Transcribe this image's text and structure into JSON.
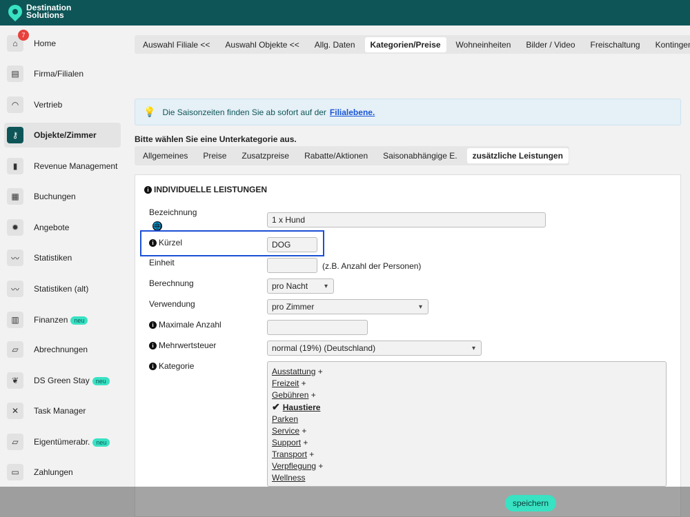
{
  "brand": {
    "line1": "Destination",
    "line2": "Solutions"
  },
  "nav": [
    {
      "label": "Home",
      "icon": "home-icon",
      "glyph": "⌂",
      "badge_count": "7",
      "neu": ""
    },
    {
      "label": "Firma/Filialen",
      "icon": "building-icon",
      "glyph": "▤",
      "neu": ""
    },
    {
      "label": "Vertrieb",
      "icon": "gauge-icon",
      "glyph": "◠",
      "neu": ""
    },
    {
      "label": "Objekte/Zimmer",
      "icon": "key-icon",
      "glyph": "⚷",
      "neu": ""
    },
    {
      "label": "Revenue Management",
      "icon": "bar-chart-icon",
      "glyph": "▮",
      "neu": ""
    },
    {
      "label": "Buchungen",
      "icon": "list-icon",
      "glyph": "▦",
      "neu": ""
    },
    {
      "label": "Angebote",
      "icon": "badge-icon",
      "glyph": "✹",
      "neu": ""
    },
    {
      "label": "Statistiken",
      "icon": "trend-icon",
      "glyph": "〰",
      "neu": ""
    },
    {
      "label": "Statistiken (alt)",
      "icon": "trend-icon",
      "glyph": "〰",
      "neu": ""
    },
    {
      "label": "Finanzen",
      "icon": "document-icon",
      "glyph": "▥",
      "neu": "neu"
    },
    {
      "label": "Abrechnungen",
      "icon": "receipt-icon",
      "glyph": "▱",
      "neu": ""
    },
    {
      "label": "DS Green Stay",
      "icon": "leaf-icon",
      "glyph": "❦",
      "neu": "neu"
    },
    {
      "label": "Task Manager",
      "icon": "tools-icon",
      "glyph": "✕",
      "neu": ""
    },
    {
      "label": "Eigentümerabr.",
      "icon": "receipt-icon",
      "glyph": "▱",
      "neu": "neu"
    },
    {
      "label": "Zahlungen",
      "icon": "card-icon",
      "glyph": "▭",
      "neu": ""
    }
  ],
  "top_tabs": [
    "Auswahl Filiale <<",
    "Auswahl Objekte <<",
    "Allg. Daten",
    "Kategorien/Preise",
    "Wohneinheiten",
    "Bilder / Video",
    "Freischaltung",
    "Kontingente"
  ],
  "top_tab_active": "Kategorien/Preise",
  "info": {
    "text": "Die Saisonzeiten finden Sie ab sofort auf der",
    "link": "Filialebene."
  },
  "subcat_title": "Bitte wählen Sie eine Unterkategorie aus.",
  "sub_tabs": [
    "Allgemeines",
    "Preise",
    "Zusatzpreise",
    "Rabatte/Aktionen",
    "Saisonabhängige E.",
    "zusätzliche Leistungen"
  ],
  "sub_tab_active": "zusätzliche Leistungen",
  "panel_title": "INDIVIDUELLE LEISTUNGEN",
  "form": {
    "bezeichnung_label": "Bezeichnung",
    "bezeichnung_value": "1 x Hund",
    "kuerzel_label": "Kürzel",
    "kuerzel_value": "DOG",
    "einheit_label": "Einheit",
    "einheit_value": "",
    "einheit_hint": "(z.B. Anzahl der Personen)",
    "berechnung_label": "Berechnung",
    "berechnung_value": "pro Nacht",
    "verwendung_label": "Verwendung",
    "verwendung_value": "pro Zimmer",
    "max_label": "Maximale Anzahl",
    "max_value": "",
    "mwst_label": "Mehrwertsteuer",
    "mwst_value": "normal (19%) (Deutschland)",
    "kategorie_label": "Kategorie"
  },
  "categories": [
    {
      "label": "Ausstattung",
      "suffix": "+",
      "checked": false
    },
    {
      "label": "Freizeit",
      "suffix": "+",
      "checked": false
    },
    {
      "label": "Gebühren",
      "suffix": "+",
      "checked": false
    },
    {
      "label": "Haustiere",
      "suffix": "",
      "checked": true
    },
    {
      "label": "Parken",
      "suffix": "",
      "checked": false
    },
    {
      "label": "Service",
      "suffix": "+",
      "checked": false
    },
    {
      "label": "Support",
      "suffix": "+",
      "checked": false
    },
    {
      "label": "Transport",
      "suffix": "+",
      "checked": false
    },
    {
      "label": "Verpflegung",
      "suffix": "+",
      "checked": false
    },
    {
      "label": "Wellness",
      "suffix": "",
      "checked": false
    }
  ],
  "save_label": "speichern",
  "colors": {
    "brand": "#0e5557",
    "accent": "#38e2c2",
    "highlight": "#1a4fd6"
  }
}
